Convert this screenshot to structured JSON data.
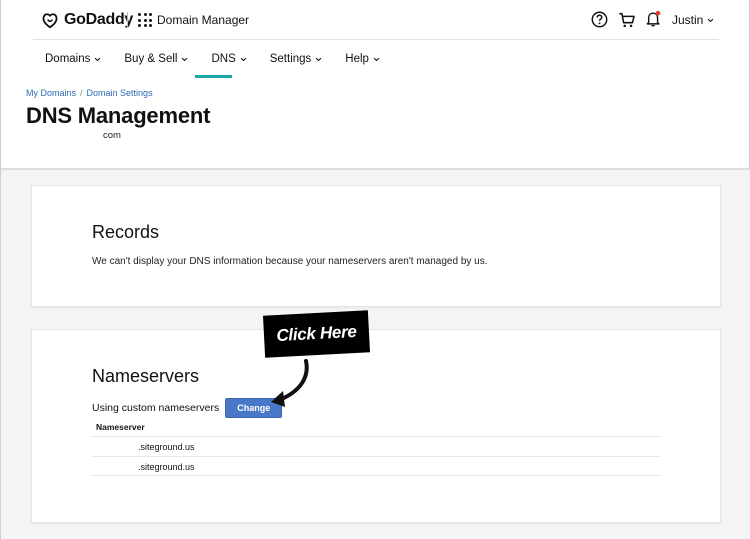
{
  "header": {
    "brand": "GoDaddy",
    "app_name": "Domain Manager",
    "user_name": "Justin"
  },
  "nav": {
    "items": [
      {
        "label": "Domains"
      },
      {
        "label": "Buy & Sell"
      },
      {
        "label": "DNS"
      },
      {
        "label": "Settings"
      },
      {
        "label": "Help"
      }
    ],
    "active": "DNS",
    "accent_color": "#1aa7a5"
  },
  "breadcrumb": {
    "items": [
      "My Domains",
      "Domain Settings"
    ]
  },
  "page": {
    "title": "DNS Management",
    "domain_suffix": "com"
  },
  "records": {
    "title": "Records",
    "message": "We can't display your DNS information because your nameservers aren't managed by us."
  },
  "nameservers": {
    "title": "Nameservers",
    "custom_label": "Using custom nameservers",
    "change_label": "Change",
    "column_header": "Nameserver",
    "rows": [
      ".siteground.us",
      ".siteground.us"
    ],
    "button_color": "#4a78c8"
  },
  "annotation": {
    "callout": "Click Here"
  },
  "icons": [
    "godaddy-logo-icon",
    "apps-grid-icon",
    "help-icon",
    "cart-icon",
    "bell-icon",
    "chevron-down-icon",
    "arrow-icon"
  ]
}
